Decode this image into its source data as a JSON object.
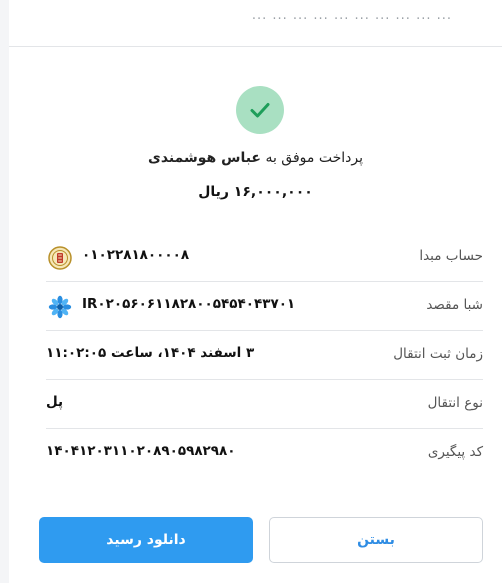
{
  "top_strip": {
    "text": "... ... ... ... ... ... ... ... ... ..."
  },
  "receipt": {
    "title_prefix": "پرداخت موفق به",
    "payee_name": "عباس هوشمندی",
    "amount": "۱۶,۰۰۰,۰۰۰ ریال",
    "rows": [
      {
        "label": "حساب مبدا",
        "value": "۰۱۰۲۲۸۱۸۰۰۰۰۸",
        "icon": "bank-melli-icon"
      },
      {
        "label": "شبا مقصد",
        "value": "IR۰۲۰۵۶۰۶۱۱۸۲۸۰۰۵۴۵۴۰۴۳۷۰۱",
        "icon": "bank-logo-flower-icon"
      },
      {
        "label": "زمان ثبت انتقال",
        "value": "۳ اسفند ۱۴۰۴، ساعت ۱۱:۰۲:۰۵"
      },
      {
        "label": "نوع انتقال",
        "value": "پل"
      },
      {
        "label": "کد پیگیری",
        "value": "۱۴۰۴۱۲۰۳۱۱۰۲۰۸۹۰۵۹۸۲۹۸۰"
      }
    ]
  },
  "buttons": {
    "download": "دانلود رسید",
    "close": "بستن"
  },
  "colors": {
    "success_bg": "#a9e0c2",
    "success_check": "#1e9e5a",
    "primary": "#2f9bf0",
    "link": "#2f8de4"
  }
}
